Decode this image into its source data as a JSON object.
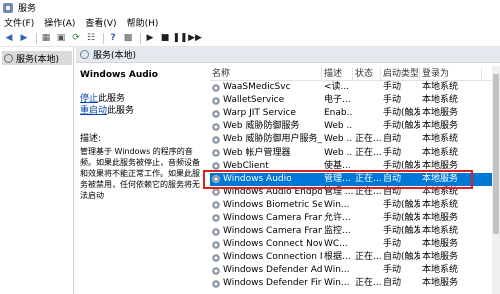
{
  "window": {
    "title": "服务"
  },
  "menu": [
    "文件(F)",
    "操作(A)",
    "查看(V)",
    "帮助(H)"
  ],
  "toolbar": {
    "buttons": [
      "back-icon",
      "forward-icon",
      "console-tree-icon",
      "properties-icon",
      "refresh-icon",
      "export-icon",
      "help-icon",
      "console-icon",
      "start-icon",
      "stop-icon",
      "pause-icon",
      "restart-icon"
    ]
  },
  "left": {
    "item": "服务(本地)"
  },
  "main": {
    "header": "服务(本地)"
  },
  "desc": {
    "name": "Windows Audio",
    "stop_link": "停止",
    "stop_suffix": "此服务",
    "restart_link": "重启动",
    "restart_suffix": "此服务",
    "label": "描述:",
    "text": "管理基于 Windows 的程序的音频。如果此服务被停止，音频设备和效果将不能正常工作。如果此服务被禁用，任何依赖它的服务将无法启动"
  },
  "columns": [
    "名称",
    "描述",
    "状态",
    "启动类型",
    "登录为"
  ],
  "rows": [
    {
      "name": "WaaSMedicSvc",
      "desc": "<读...",
      "status": "",
      "startup": "手动",
      "logon": "本地系统"
    },
    {
      "name": "WalletService",
      "desc": "电子...",
      "status": "",
      "startup": "手动",
      "logon": "本地系统"
    },
    {
      "name": "Warp JIT Service",
      "desc": "Enab...",
      "status": "",
      "startup": "手动(触发...",
      "logon": "本地服务"
    },
    {
      "name": "Web 威胁防御服务",
      "desc": "Web ...",
      "status": "",
      "startup": "手动(触发...",
      "logon": "本地服务"
    },
    {
      "name": "Web 威胁防御用户服务_a1...",
      "desc": "Web ...",
      "status": "正在...",
      "startup": "自动",
      "logon": "本地系统"
    },
    {
      "name": "Web 帐户管理器",
      "desc": "Web ...",
      "status": "正在...",
      "startup": "手动",
      "logon": "本地系统"
    },
    {
      "name": "WebClient",
      "desc": "使基...",
      "status": "",
      "startup": "手动(触发...",
      "logon": "本地服务"
    },
    {
      "name": "Windows Audio",
      "desc": "管理...",
      "status": "正在...",
      "startup": "自动",
      "logon": "本地服务",
      "selected": true
    },
    {
      "name": "Windows Audio Endpoint...",
      "desc": "管理 ...",
      "status": "正在...",
      "startup": "自动",
      "logon": "本地系统"
    },
    {
      "name": "Windows Biometric Servi...",
      "desc": "Win...",
      "status": "",
      "startup": "手动(触发...",
      "logon": "本地系统"
    },
    {
      "name": "Windows Camera Frame ...",
      "desc": "允许...",
      "status": "",
      "startup": "手动(触发...",
      "logon": "本地服务"
    },
    {
      "name": "Windows Camera Frame ...",
      "desc": "监控...",
      "status": "",
      "startup": "手动(触发...",
      "logon": "本地系统"
    },
    {
      "name": "Windows Connect Now -...",
      "desc": "WC...",
      "status": "",
      "startup": "手动",
      "logon": "本地服务"
    },
    {
      "name": "Windows Connection M...",
      "desc": "根据...",
      "status": "正在...",
      "startup": "自动(触发...",
      "logon": "本地服务"
    },
    {
      "name": "Windows Defender Adva...",
      "desc": "Win...",
      "status": "",
      "startup": "手动",
      "logon": "本地系统"
    },
    {
      "name": "Windows Defender Firew...",
      "desc": "Win...",
      "status": "正在...",
      "startup": "自动",
      "logon": "本地服务"
    }
  ]
}
